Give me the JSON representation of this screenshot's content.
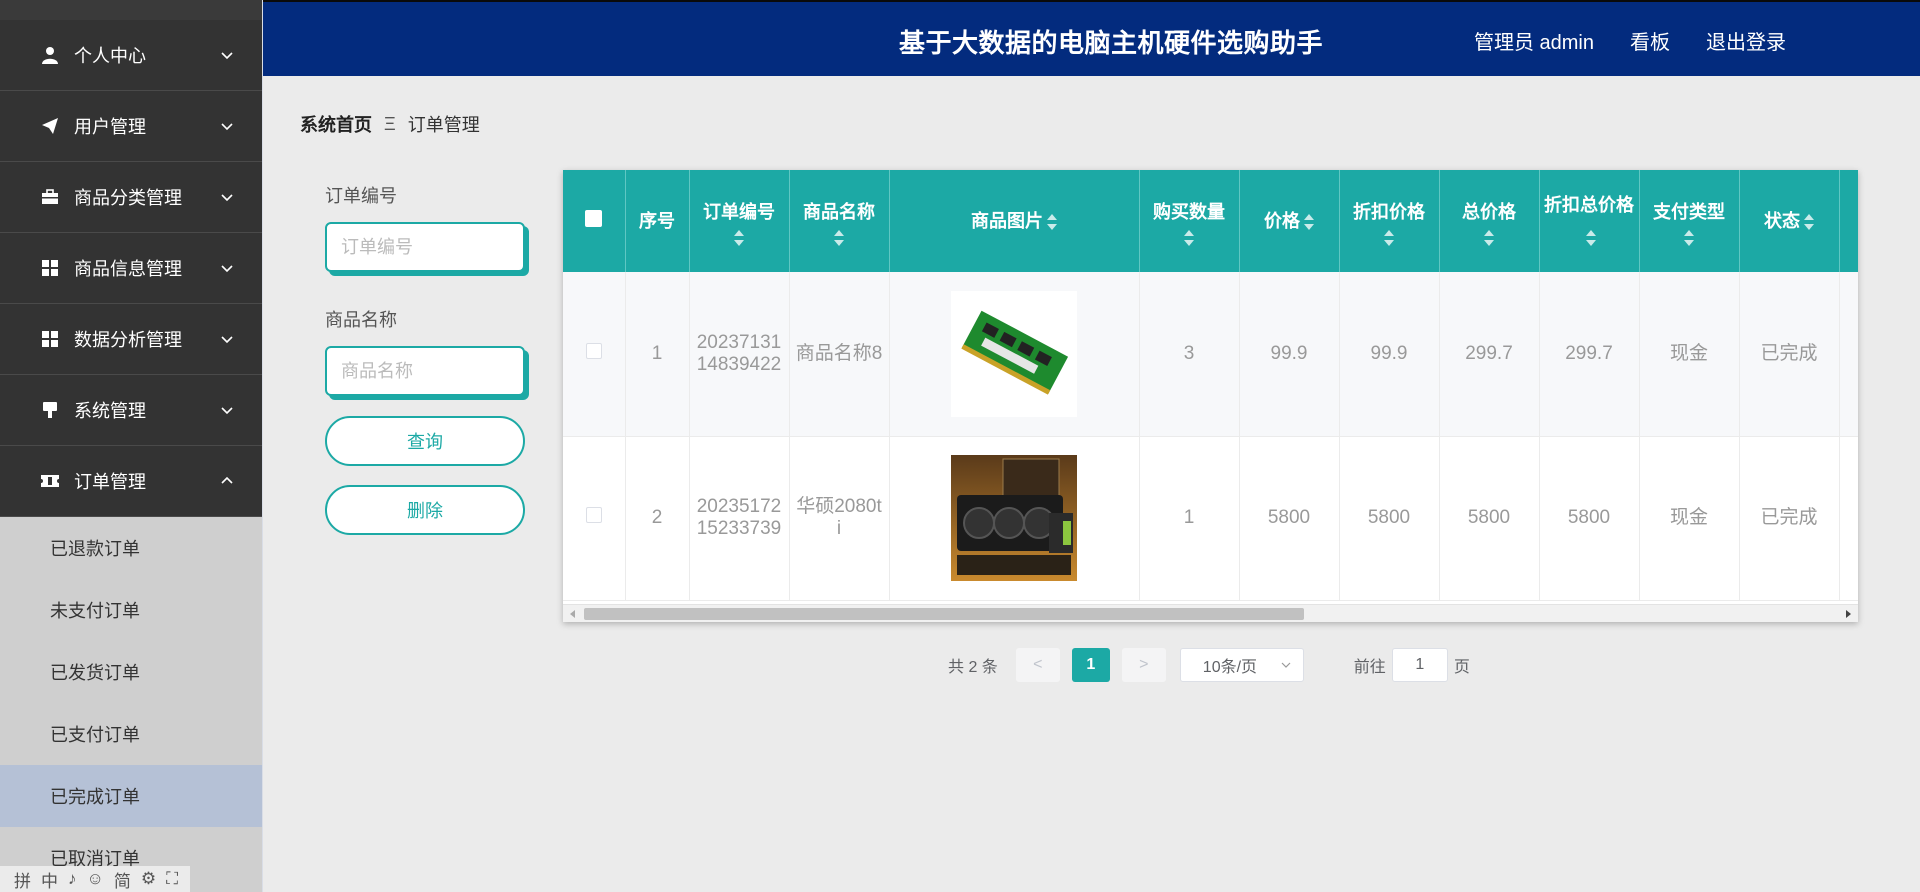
{
  "header": {
    "title": "基于大数据的电脑主机硬件选购助手",
    "user": "管理员 admin",
    "board": "看板",
    "logout": "退出登录"
  },
  "sidebar": {
    "items": [
      {
        "label": "个人中心",
        "icon": "user-icon"
      },
      {
        "label": "用户管理",
        "icon": "paper-plane-icon"
      },
      {
        "label": "商品分类管理",
        "icon": "briefcase-icon"
      },
      {
        "label": "商品信息管理",
        "icon": "grid-icon"
      },
      {
        "label": "数据分析管理",
        "icon": "grid-icon"
      },
      {
        "label": "系统管理",
        "icon": "brush-icon"
      },
      {
        "label": "订单管理",
        "icon": "ticket-icon"
      }
    ],
    "submenu": [
      "已退款订单",
      "未支付订单",
      "已发货订单",
      "已支付订单",
      "已完成订单",
      "已取消订单"
    ],
    "active_submenu": "已完成订单"
  },
  "ime_bar": {
    "glyphs": [
      "拼",
      "中",
      "♪",
      "☺",
      "简",
      "⚙",
      "⛶"
    ]
  },
  "breadcrumb": {
    "home": "系统首页",
    "separator": "Ξ",
    "current": "订单管理"
  },
  "search": {
    "order_no_label": "订单编号",
    "order_no_placeholder": "订单编号",
    "product_name_label": "商品名称",
    "product_name_placeholder": "商品名称",
    "query_button": "查询",
    "delete_button": "删除"
  },
  "table": {
    "columns": [
      "序号",
      "订单编号",
      "商品名称",
      "商品图片",
      "购买数量",
      "价格",
      "折扣价格",
      "总价格",
      "折扣总价格",
      "支付类型",
      "状态"
    ],
    "rows": [
      {
        "index": "1",
        "order_no": "2023713114839422",
        "product_name": "商品名称8",
        "image": "ram-module-image",
        "quantity": "3",
        "price": "99.9",
        "discount_price": "99.9",
        "total": "299.7",
        "discount_total": "299.7",
        "pay_type": "现金",
        "status": "已完成"
      },
      {
        "index": "2",
        "order_no": "2023517215233739",
        "product_name": "华硕2080ti",
        "image": "graphics-card-image",
        "quantity": "1",
        "price": "5800",
        "discount_price": "5800",
        "total": "5800",
        "discount_total": "5800",
        "pay_type": "现金",
        "status": "已完成"
      }
    ]
  },
  "pagination": {
    "total": "共 2 条",
    "prev": "<",
    "current": "1",
    "next": ">",
    "page_size": "10条/页",
    "goto_label": "前往",
    "goto_value": "1",
    "page_suffix": "页"
  },
  "colors": {
    "header_bg": "#032b7e",
    "accent": "#1ca9a5",
    "sidebar_bg": "#333333",
    "active_sub": "#b5c1d6"
  }
}
